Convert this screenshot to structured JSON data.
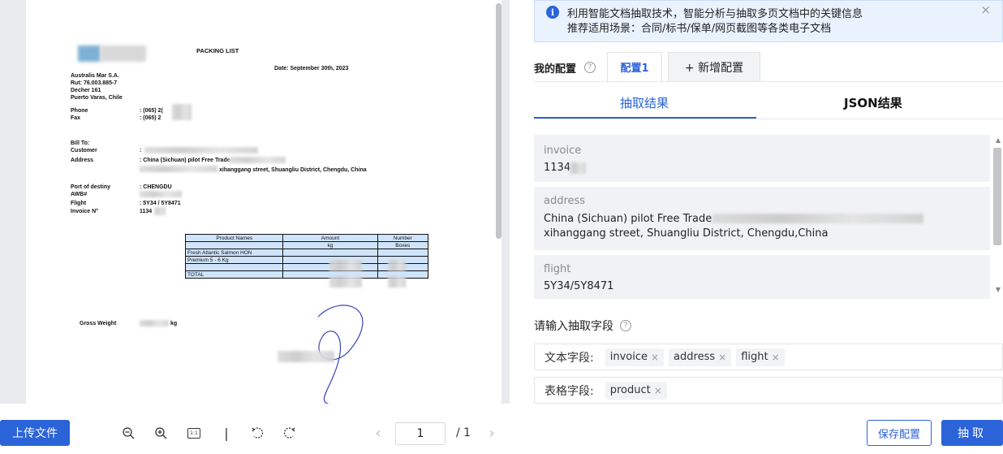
{
  "viewer": {
    "document": {
      "title": "PACKING LIST",
      "date": "Date: September 30th, 2023",
      "company_lines": [
        "Australis Mar S.A.",
        "Rut: 76.003.885-7",
        "Decher 161",
        "Puerto Varas, Chile"
      ],
      "phone_label": "Phone",
      "phone_value": ": (065) 2(",
      "fax_label": "Fax",
      "fax_value": ": (065) 2",
      "bill_to": "Bill To:",
      "customer_label": "Customer",
      "customer_value": ":",
      "address_label": "Address",
      "address_value": ": China (Sichuan) pilot Free Trade",
      "address_line2": "xihanggang street, Shuangliu District, Chengdu, China",
      "port_label": "Port of destiny",
      "port_value": ": CHENGDU",
      "awb_label": "AWB#",
      "flight_label": "Flight",
      "flight_value": ": 5Y34 / 5Y8471",
      "invoice_label": "Invoice N°",
      "invoice_value": "1134",
      "table": {
        "headers": [
          "Product Names",
          "Amount",
          "Number"
        ],
        "subheaders": [
          "",
          "kg",
          "Boxes"
        ],
        "rows": [
          [
            "Fresh Atlantic Salmon HON",
            "",
            ""
          ],
          [
            "Premium 5 - 6 Kg",
            "",
            ""
          ],
          [
            "",
            "",
            ""
          ],
          [
            "TOTAL",
            "",
            ""
          ]
        ]
      },
      "gross_weight_label": "Gross Weight",
      "gross_weight_unit": "kg"
    },
    "toolbar": {
      "upload_label": "上传文件",
      "zoom_out_icon": "zoom-out-icon",
      "zoom_in_icon": "zoom-in-icon",
      "actual_size_label": "1:1",
      "separator": "|",
      "rotate_left_icon": "rotate-left-icon",
      "rotate_right_icon": "rotate-right-icon",
      "prev_icon": "‹",
      "next_icon": "›",
      "page_value": "1",
      "page_total": "/ 1"
    }
  },
  "panel": {
    "alert": {
      "line1": "利用智能文档抽取技术，智能分析与抽取多页文档中的关键信息",
      "line2": "推荐适用场景：合同/标书/保单/网页截图等各类电子文档",
      "info_icon": "i",
      "close_icon": "×"
    },
    "config": {
      "label": "我的配置",
      "tab_active": "配置1",
      "tab_add": "+ 新增配置"
    },
    "result_tabs": {
      "extract": "抽取结果",
      "json": "JSON结果"
    },
    "results": [
      {
        "key": "invoice",
        "lines": [
          "1134"
        ]
      },
      {
        "key": "address",
        "lines": [
          "China (Sichuan) pilot Free Trade",
          "xihanggang street, Shuangliu District, Chengdu,China"
        ]
      },
      {
        "key": "flight",
        "lines": [
          "5Y34/5Y8471"
        ]
      }
    ],
    "field_input": {
      "label": "请输入抽取字段",
      "text_fields_label": "文本字段:",
      "text_fields": [
        "invoice",
        "address",
        "flight"
      ],
      "table_fields_label": "表格字段:",
      "table_fields": [
        "product"
      ],
      "remove_icon": "×"
    },
    "buttons": {
      "save": "保存配置",
      "extract": "抽取"
    },
    "colors": {
      "accent": "#2b63d9",
      "alert_bg": "#eaf2fe"
    }
  }
}
